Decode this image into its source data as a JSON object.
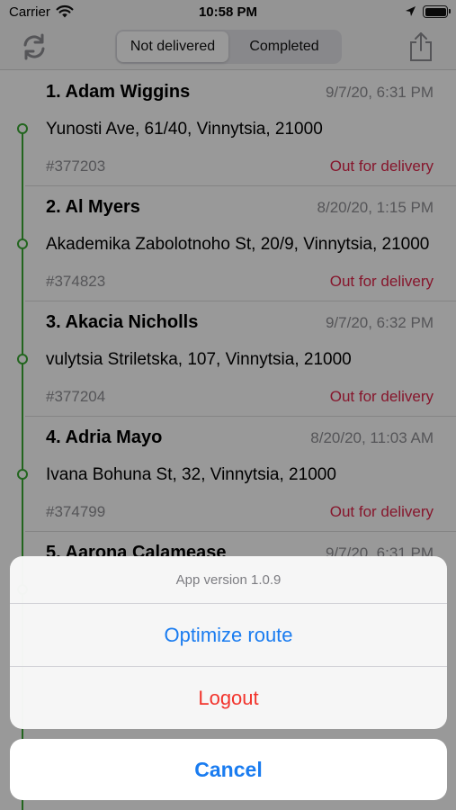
{
  "status_bar": {
    "carrier": "Carrier",
    "time": "10:58 PM"
  },
  "nav": {
    "tabs": [
      {
        "label": "Not delivered",
        "selected": true
      },
      {
        "label": "Completed",
        "selected": false
      }
    ]
  },
  "orders": [
    {
      "name": "1. Adam Wiggins",
      "date": "9/7/20, 6:31 PM",
      "address": "Yunosti Ave, 61/40, Vinnytsia, 21000",
      "number": "#377203",
      "status": "Out for delivery"
    },
    {
      "name": "2. Al Myers",
      "date": "8/20/20, 1:15 PM",
      "address": "Akademika Zabolotnoho St, 20/9, Vinnytsia, 21000",
      "number": "#374823",
      "status": "Out for delivery"
    },
    {
      "name": "3. Akacia Nicholls",
      "date": "9/7/20, 6:32 PM",
      "address": "vulytsia Striletska, 107, Vinnytsia, 21000",
      "number": "#377204",
      "status": "Out for delivery"
    },
    {
      "name": "4. Adria Mayo",
      "date": "8/20/20, 11:03 AM",
      "address": "Ivana Bohuna St, 32, Vinnytsia, 21000",
      "number": "#374799",
      "status": "Out for delivery"
    },
    {
      "name": "5. Aarona Calamease",
      "date": "9/7/20, 6:31 PM",
      "address": "",
      "number": "",
      "status": ""
    }
  ],
  "action_sheet": {
    "title": "App version 1.0.9",
    "optimize_label": "Optimize route",
    "logout_label": "Logout",
    "cancel_label": "Cancel"
  },
  "colors": {
    "accent": "#1a7cf0",
    "destructive": "#f2342c",
    "status": "#e0254a",
    "route": "#3aa832"
  }
}
